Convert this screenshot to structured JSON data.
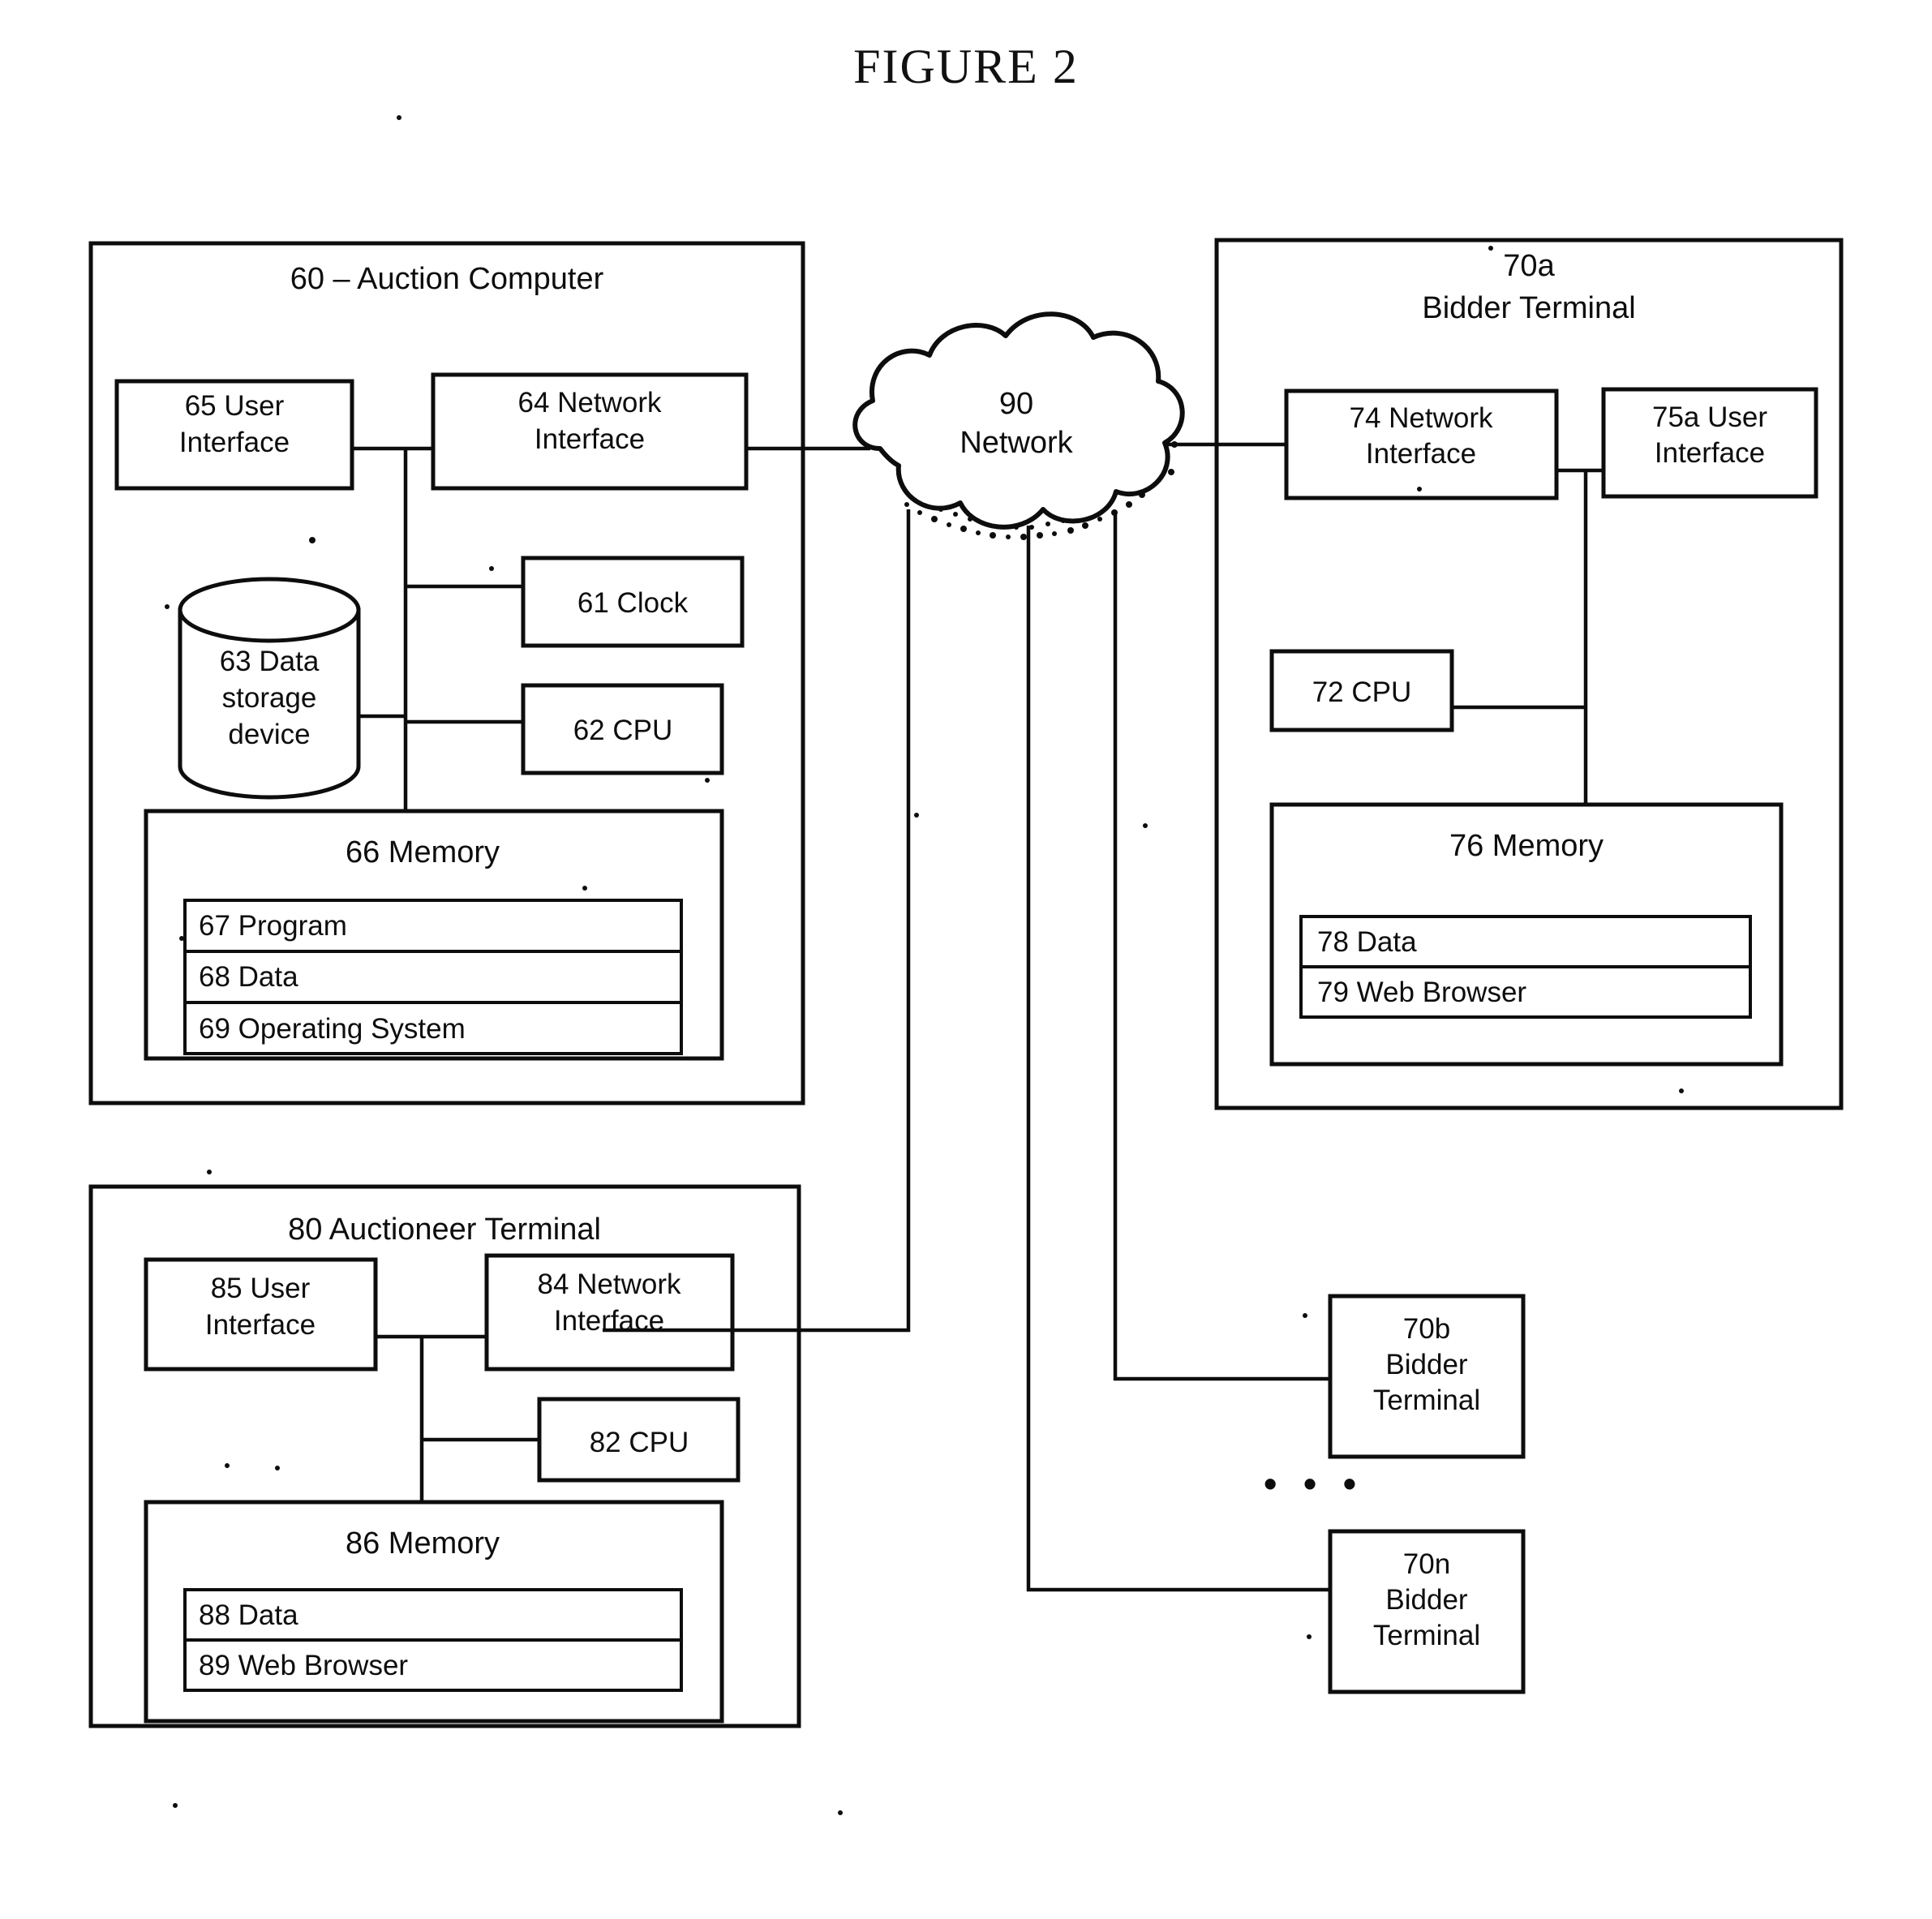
{
  "figure": {
    "title": "FIGURE 2"
  },
  "auction_computer": {
    "title": "60 – Auction Computer",
    "user_interface": {
      "line1": "65  User",
      "line2": "Interface"
    },
    "network_interface": {
      "line1": "64  Network",
      "line2": "Interface"
    },
    "data_storage": {
      "line1": "63  Data",
      "line2": "storage",
      "line3": "device"
    },
    "clock": "61   Clock",
    "cpu": "62   CPU",
    "memory": {
      "title": "66  Memory",
      "rows": [
        "67  Program",
        "68  Data",
        "69  Operating System"
      ]
    }
  },
  "network": {
    "line1": "90",
    "line2": "Network"
  },
  "bidder_terminal_a": {
    "title_line1": "70a",
    "title_line2": "Bidder Terminal",
    "network_interface": {
      "line1": "74  Network",
      "line2": "Interface"
    },
    "user_interface": {
      "line1": "75a  User",
      "line2": "Interface"
    },
    "cpu": "72 CPU",
    "memory": {
      "title": "76 Memory",
      "rows": [
        "78  Data",
        "79  Web Browser"
      ]
    }
  },
  "auctioneer_terminal": {
    "title": "80  Auctioneer Terminal",
    "user_interface": {
      "line1": "85 User",
      "line2": "Interface"
    },
    "network_interface": {
      "line1": "84 Network",
      "line2": "Interface"
    },
    "cpu": "82 CPU",
    "memory": {
      "title": "86 Memory",
      "rows": [
        "88  Data",
        "89  Web Browser"
      ]
    }
  },
  "other_bidder_terminals": {
    "b": {
      "line1": "70b",
      "line2": "Bidder",
      "line3": "Terminal"
    },
    "ellipsis": "• • •",
    "n": {
      "line1": "70n",
      "line2": "Bidder",
      "line3": "Terminal"
    }
  },
  "colors": {
    "ink": "#0d0d0d",
    "paper": "#ffffff"
  }
}
